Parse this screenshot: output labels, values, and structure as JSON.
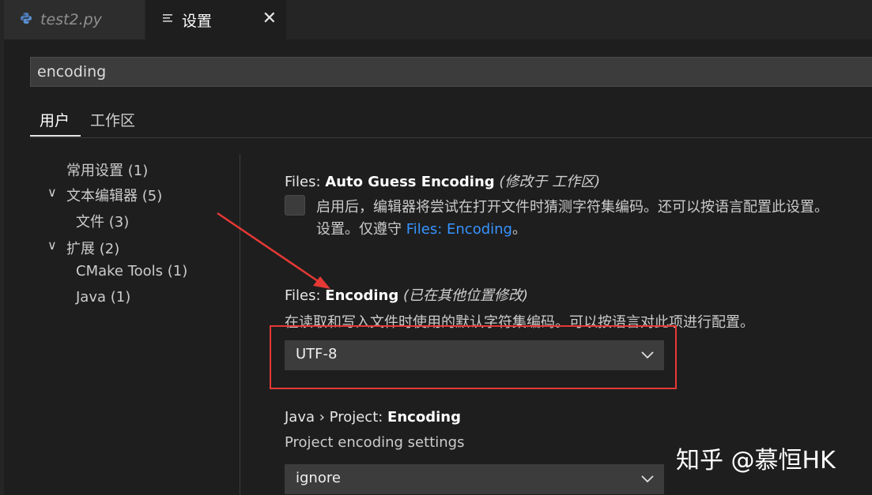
{
  "tabs": [
    {
      "label": "test2.py",
      "icon": "python-icon",
      "active": false
    },
    {
      "label": "设置",
      "icon": "settings-list-icon",
      "active": true
    }
  ],
  "search": {
    "value": "encoding"
  },
  "scope_tabs": {
    "user": "用户",
    "workspace": "工作区"
  },
  "toc": [
    {
      "label": "常用设置 (1)"
    },
    {
      "label": "文本编辑器 (5)",
      "expanded": true
    },
    {
      "label": "文件 (3)"
    },
    {
      "label": "扩展 (2)",
      "expanded": true
    },
    {
      "label": "CMake Tools (1)"
    },
    {
      "label": "Java (1)"
    }
  ],
  "settings": {
    "auto_guess": {
      "category": "Files: ",
      "name": "Auto Guess Encoding",
      "modified": "(修改于 工作区)",
      "desc_line1": "启用后，编辑器将尝试在打开文件时猜测字符集编码。还可以按语言配置此设置。",
      "desc_line2_prefix": "设置。仅遵守 ",
      "desc_link": "Files: Encoding",
      "desc_line2_suffix": "。",
      "checked": false
    },
    "encoding": {
      "category": "Files: ",
      "name": "Encoding",
      "modified": "(已在其他位置修改)",
      "desc": "在读取和写入文件时使用的默认字符集编码。可以按语言对此项进行配置。",
      "value": "UTF-8"
    },
    "java_encoding": {
      "category": "Java › Project: ",
      "name": "Encoding",
      "desc": "Project encoding settings",
      "value": "ignore"
    }
  },
  "watermark": "知乎 @慕恒HK",
  "colors": {
    "accent_link": "#3794ff",
    "highlight_red": "#e53935",
    "background": "#1e1e1e"
  }
}
